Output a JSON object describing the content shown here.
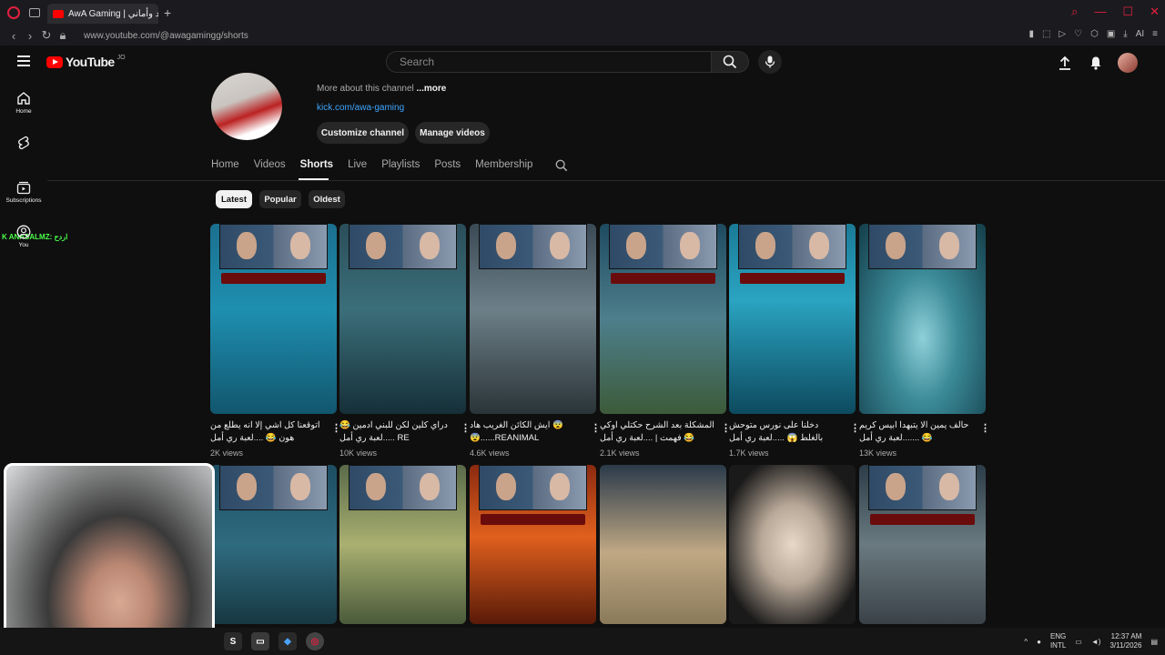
{
  "browser": {
    "tab_title": "AwA Gaming | أحمد وأماني",
    "url": "www.youtube.com/@awagamingg/shorts",
    "ai_label": "AI",
    "colors": {
      "accent": "#e2203f"
    }
  },
  "header": {
    "logo_text": "YouTube",
    "country_code": "JO",
    "search_placeholder": "Search"
  },
  "sidebar": {
    "items": [
      {
        "label": "Home",
        "icon": "home-icon"
      },
      {
        "label": "Shorts",
        "icon": "shorts-icon"
      },
      {
        "label": "Subscriptions",
        "icon": "subscriptions-icon"
      },
      {
        "label": "You",
        "icon": "you-icon"
      }
    ],
    "overlay_text": "K ANASALMZ: اردح"
  },
  "channel": {
    "about_text": "More about this channel",
    "more_label": "...more",
    "link": "kick.com/awa-gaming",
    "customize_label": "Customize channel",
    "manage_label": "Manage videos"
  },
  "tabs": [
    "Home",
    "Videos",
    "Shorts",
    "Live",
    "Playlists",
    "Posts",
    "Membership"
  ],
  "active_tab": "Shorts",
  "chips": [
    "Latest",
    "Popular",
    "Oldest"
  ],
  "active_chip": "Latest",
  "shorts_row1": [
    {
      "title": "اتوقعنا كل اشي إلا انه يطلع من هون 😂 ....لعبة ري أمل",
      "views": "2K views"
    },
    {
      "title": "دراي كلين لكن للبني ادمين 😂 RE .....لعبة ري أمل",
      "views": "10K views"
    },
    {
      "title": "😨 ايش الكائن الغريب هاد REANIMAL......😨",
      "views": "4.6K views"
    },
    {
      "title": "المشكلة بعد الشرح حكتلي اوكي 😂 فهمت | ....لعبة ري أمل",
      "views": "2.1K views"
    },
    {
      "title": "دخلنا على نورس متوحش بالغلط 😱 .....لعبة ري أمل",
      "views": "1.7K views"
    },
    {
      "title": "حالف يمين الا يتبهدا ابيس كريم 😂 .......لعبة ري أمل",
      "views": "13K views"
    }
  ],
  "taskbar": {
    "lang_top": "ENG",
    "lang_bottom": "INTL",
    "time": "12:37 AM",
    "date": "3/11/2026"
  }
}
